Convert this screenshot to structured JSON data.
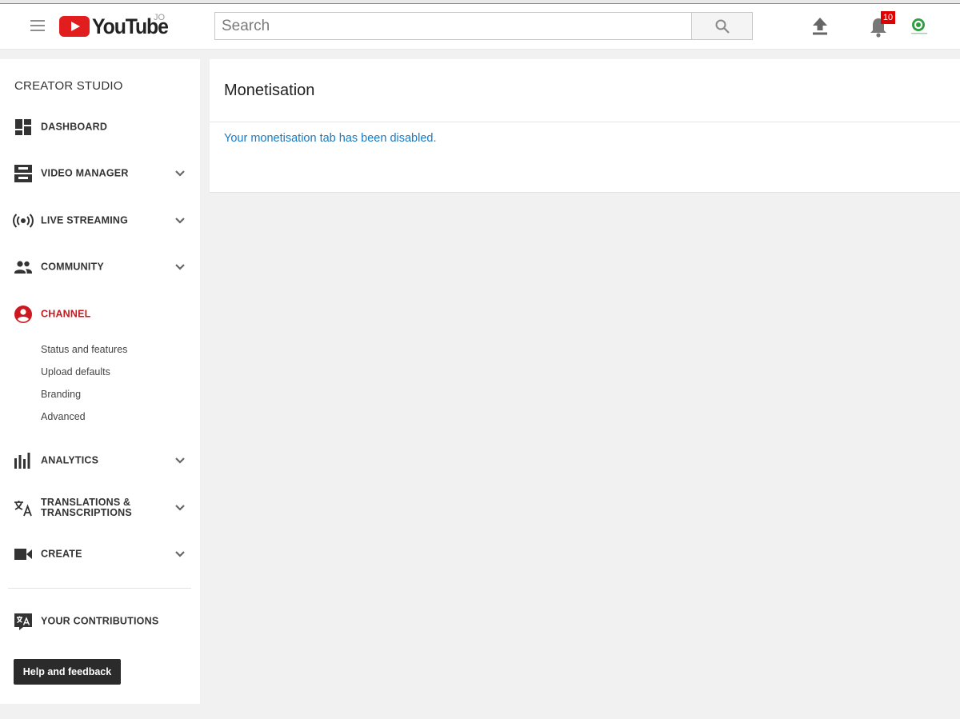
{
  "header": {
    "logo_text": "YouTube",
    "country_code": "JO",
    "search_placeholder": "Search",
    "notification_count": "10",
    "icons": [
      "menu-icon",
      "search-icon",
      "upload-icon",
      "bell-icon"
    ]
  },
  "sidebar": {
    "title": "CREATOR STUDIO",
    "items": [
      {
        "label": "DASHBOARD",
        "icon": "dashboard-icon",
        "expandable": false
      },
      {
        "label": "VIDEO MANAGER",
        "icon": "video-manager-icon",
        "expandable": true
      },
      {
        "label": "LIVE STREAMING",
        "icon": "live-streaming-icon",
        "expandable": true
      },
      {
        "label": "COMMUNITY",
        "icon": "community-icon",
        "expandable": true
      },
      {
        "label": "CHANNEL",
        "icon": "channel-icon",
        "expandable": false,
        "active": true
      },
      {
        "label": "ANALYTICS",
        "icon": "analytics-icon",
        "expandable": true
      },
      {
        "label": "TRANSLATIONS &",
        "label2": "TRANSCRIPTIONS",
        "icon": "translate-icon",
        "expandable": true
      },
      {
        "label": "CREATE",
        "icon": "create-icon",
        "expandable": true
      }
    ],
    "channel_subitems": [
      "Status and features",
      "Upload defaults",
      "Branding",
      "Advanced"
    ],
    "contributions_label": "YOUR CONTRIBUTIONS",
    "help_button": "Help and feedback"
  },
  "main": {
    "title": "Monetisation",
    "message": "Your monetisation tab has been disabled."
  },
  "colors": {
    "accent_red": "#cc181e",
    "link_blue": "#167ac6",
    "badge_red": "#e00000"
  }
}
